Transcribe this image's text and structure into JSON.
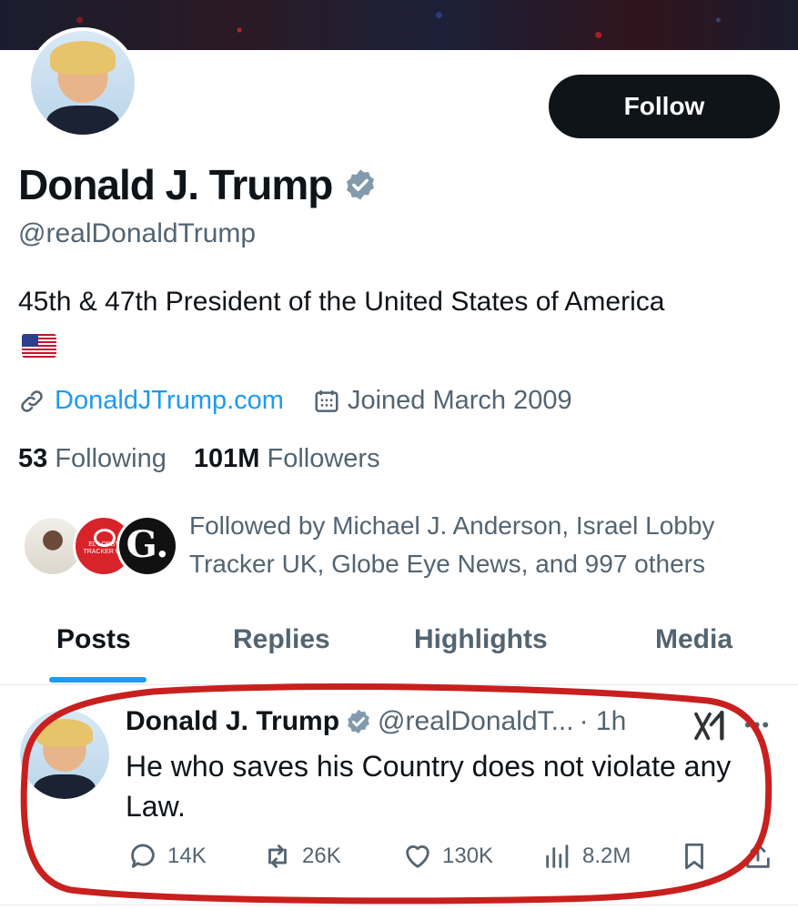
{
  "profile": {
    "name": "Donald J. Trump",
    "handle": "@realDonaldTrump",
    "bio": "45th & 47th President of the United States of America",
    "link": "DonaldJTrump.com",
    "joined": "Joined March 2009",
    "following_count": "53",
    "following_label": "Following",
    "followers_count": "101M",
    "followers_label": "Followers",
    "followed_by": "Followed by Michael J. Anderson, Israel Lobby Tracker UK, Globe Eye News, and 997 others",
    "follow_button": "Follow",
    "mini_avatar_text": "EL LOBBY TRACKER UK",
    "mini_avatar_letter": "G."
  },
  "tabs": [
    {
      "label": "Posts",
      "active": true
    },
    {
      "label": "Replies",
      "active": false
    },
    {
      "label": "Highlights",
      "active": false
    },
    {
      "label": "Media",
      "active": false
    }
  ],
  "post": {
    "author": "Donald J. Trump",
    "handle": "@realDonaldT...",
    "time": "· 1h",
    "text": "He who saves his Country does not violate any Law.",
    "replies": "14K",
    "reposts": "26K",
    "likes": "130K",
    "views": "8.2M"
  },
  "colors": {
    "accent": "#1d9bf0",
    "verified": "#829aab",
    "highlight_circle": "#c8201e",
    "text_primary": "#0f1419",
    "text_secondary": "#536471"
  }
}
